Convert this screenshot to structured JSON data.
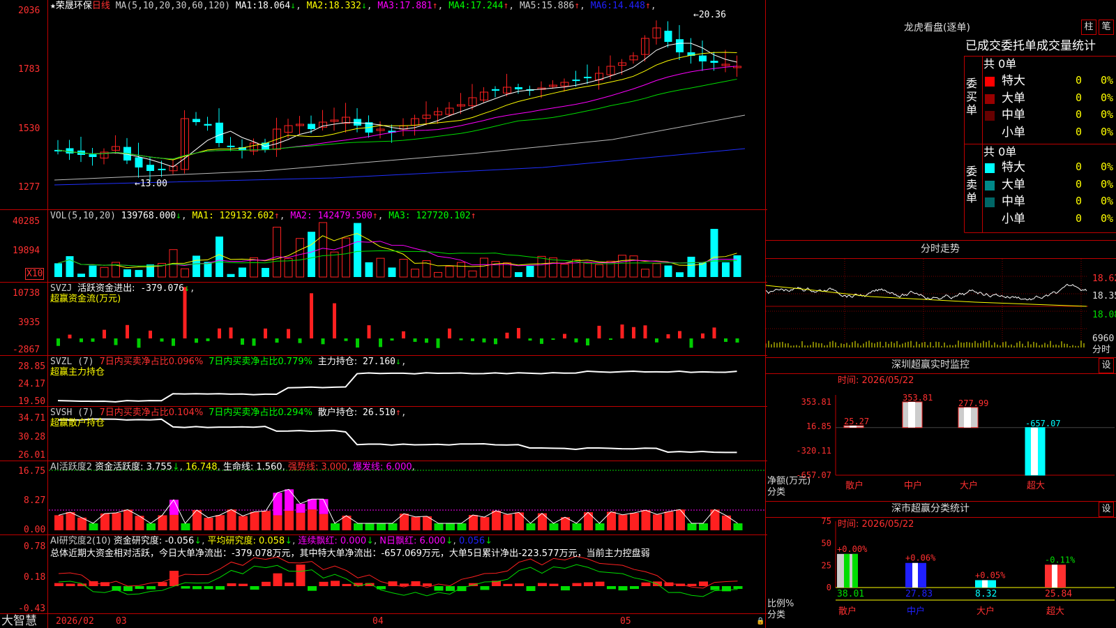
{
  "colors": {
    "up": "#ff2020",
    "down": "#00ffff",
    "green": "#00dd00",
    "frame": "#c00000",
    "white": "#ffffff",
    "yellow": "#ffff00",
    "magenta": "#ff00ff",
    "blue": "#2020ff",
    "gray": "#aaaaaa"
  },
  "main": {
    "star": "★",
    "stock_name": "荣晟环保",
    "period": "日线",
    "ma_params": "MA(5,10,20,30,60,120)",
    "ma": [
      {
        "name": "MA1:",
        "value": "18.064",
        "arrow": "↓",
        "color": "#ffffff"
      },
      {
        "name": "MA2:",
        "value": "18.332",
        "arrow": "↓",
        "color": "#ffff00"
      },
      {
        "name": "MA3:",
        "value": "17.881",
        "arrow": "↑",
        "color": "#ff00ff"
      },
      {
        "name": "MA4:",
        "value": "17.244",
        "arrow": "↑",
        "color": "#00ff00"
      },
      {
        "name": "MA5:",
        "value": "15.886",
        "arrow": "↑",
        "color": "#cccccc"
      },
      {
        "name": "MA6:",
        "value": "14.448",
        "arrow": "↑",
        "color": "#2020ff"
      }
    ],
    "y_ticks": [
      "2036",
      "1783",
      "1530",
      "1277"
    ],
    "high_mark": "20.36",
    "low_mark": "13.00"
  },
  "vol": {
    "header": "VOL(5,10,20)",
    "value": "139768.000",
    "arrow": "↓",
    "ma1": "MA1: 129132.602",
    "ma1_arrow": "↑",
    "ma2": "MA2: 142479.500",
    "ma2_arrow": "↑",
    "ma3": "MA3: 127720.102",
    "ma3_arrow": "↑",
    "y_ticks": [
      "40285",
      "19894"
    ],
    "unit": "X10"
  },
  "svzj": {
    "header": "SVZJ",
    "title": "活跃资金进出:",
    "value": "-379.076",
    "arrow": "↓",
    "sub": "超赢资金流(万元)",
    "y_ticks": [
      "10738",
      "3935",
      "-2867"
    ]
  },
  "svzl": {
    "header": "SVZL (7)",
    "t1": "7日内买卖净占比0.096%",
    "t2": "7日内买卖净占比0.779%",
    "t3": "主力持仓:",
    "value": "27.160",
    "arrow": "↓",
    "sub": "超赢主力持仓",
    "y_ticks": [
      "28.85",
      "24.17",
      "19.50"
    ]
  },
  "svsh": {
    "header": "SVSH (7)",
    "t1": "7日内买卖净占比0.104%",
    "t2": "7日内买卖净占比0.294%",
    "t3": "散户持仓:",
    "value": "26.510",
    "arrow": "↑",
    "sub": "超赢散户持仓",
    "y_ticks": [
      "34.71",
      "30.28",
      "26.01"
    ]
  },
  "ai1": {
    "header": "AI活跃度2",
    "t1": "资金活跃度:",
    "v1": "3.755",
    "a1": "↓",
    "v2": "16.748",
    "t3": "生命线:",
    "v3": "1.560",
    "t4": "强势线:",
    "v4": "3.000",
    "t5": "爆发线:",
    "v5": "6.000",
    "y_ticks": [
      "16.75",
      "8.27",
      "0.00"
    ]
  },
  "ai2": {
    "header": "AI研究度2(10)",
    "t1": "资金研究度:",
    "v1": "-0.056",
    "a1": "↓",
    "t2": "平均研究度:",
    "v2": "0.058",
    "a2": "↓",
    "t3": "连续飘红:",
    "v3": "0.000",
    "a3": "↓",
    "t4": "N日飘红:",
    "v4": "6.000",
    "a4": "↓",
    "v5": "0.056",
    "a5": "↓",
    "summary": "总体近期大资金相对活跃，今日大单净流出：-379.078万元，其中特大单净流出：-657.069万元，大单5日累计净出-223.577万元，当前主力控盘弱",
    "y_ticks": [
      "0.78",
      "0.18",
      "-0.43"
    ]
  },
  "xaxis": {
    "logo": "大智慧",
    "labels": [
      "2026/02",
      "03",
      "04",
      "05"
    ]
  },
  "right": {
    "dragon": {
      "title": "龙虎看盘(逐单)",
      "btn1": "柱",
      "btn2": "笔",
      "tabs": "已成交委托单成交量统计",
      "buy": {
        "side": "委买单",
        "total": "共 0单",
        "rows": [
          {
            "name": "特大",
            "val": "0",
            "pct": "0%",
            "color": "#ff0000"
          },
          {
            "name": "大单",
            "val": "0",
            "pct": "0%",
            "color": "#990000"
          },
          {
            "name": "中单",
            "val": "0",
            "pct": "0%",
            "color": "#660000"
          },
          {
            "name": "小单",
            "val": "0",
            "pct": "0%",
            "color": "#000000"
          }
        ]
      },
      "sell": {
        "side": "委卖单",
        "total": "共 0单",
        "rows": [
          {
            "name": "特大",
            "val": "0",
            "pct": "0%",
            "color": "#00ffff"
          },
          {
            "name": "大单",
            "val": "0",
            "pct": "0%",
            "color": "#008888"
          },
          {
            "name": "中单",
            "val": "0",
            "pct": "0%",
            "color": "#006666"
          },
          {
            "name": "小单",
            "val": "0",
            "pct": "0%",
            "color": "#000000"
          }
        ]
      }
    },
    "intraday": {
      "title": "分时走势",
      "prices": [
        "18.62",
        "18.35",
        "18.08"
      ],
      "vol": "6960",
      "vol_label": "分时"
    },
    "monitor": {
      "title": "深圳超赢实时监控",
      "btn": "设",
      "time": "时间: 2026/05/22",
      "ticks": [
        "353.81",
        "16.85",
        "-320.11",
        "-657.07"
      ],
      "y_label1": "净额(万元)",
      "y_label2": "分类",
      "bars": [
        {
          "cat": "散户",
          "value": 25.27,
          "label": "25.27"
        },
        {
          "cat": "中户",
          "value": 353.81,
          "label": "353.81"
        },
        {
          "cat": "大户",
          "value": 277.99,
          "label": "277.99"
        },
        {
          "cat": "超大",
          "value": -657.07,
          "label": "-657.07"
        }
      ]
    },
    "classify": {
      "title": "深市超赢分类统计",
      "btn": "设",
      "time": "时间: 2026/05/22",
      "ticks": [
        "75",
        "50",
        "25",
        "0"
      ],
      "y_label1": "比例%",
      "y_label2": "分类",
      "bars": [
        {
          "cat": "散户",
          "value": 38.01,
          "label": "38.01",
          "change": "+0.00%"
        },
        {
          "cat": "中户",
          "value": 27.83,
          "label": "27.83",
          "change": "+0.06%"
        },
        {
          "cat": "大户",
          "value": 8.32,
          "label": "8.32",
          "change": "+0.05%"
        },
        {
          "cat": "超大",
          "value": 25.84,
          "label": "25.84",
          "change": "-0.11%"
        }
      ]
    }
  }
}
